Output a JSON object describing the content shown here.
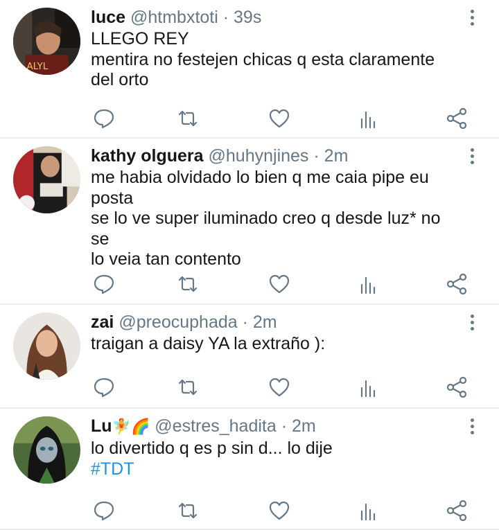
{
  "tweets": [
    {
      "name": "luce",
      "emoji": "",
      "handle": "@htmbxtoti",
      "dot": "·",
      "time": "39s",
      "lines": [
        "LLEGO REY",
        "mentira no festejen chicas q esta claramente",
        "del orto"
      ],
      "hashtag": ""
    },
    {
      "name": "kathy olguera",
      "emoji": "",
      "handle": "@huhynjines",
      "dot": "·",
      "time": "2m",
      "lines": [
        "me habia olvidado lo bien q me caia pipe eu",
        "posta",
        "se lo ve super iluminado creo q desde luz* no se",
        "lo veia tan contento"
      ],
      "hashtag": ""
    },
    {
      "name": "zai",
      "emoji": "",
      "handle": "@preocuphada",
      "dot": "·",
      "time": "2m",
      "lines": [
        "traigan a daisy YA la extraño ):"
      ],
      "hashtag": ""
    },
    {
      "name": "Lu",
      "emoji": "🧚🌈",
      "handle": "@estres_hadita",
      "dot": "·",
      "time": "2m",
      "lines": [
        "lo divertido q es p sin d... lo dije"
      ],
      "hashtag": "#TDT"
    }
  ],
  "icons": {
    "reply": "reply-icon",
    "retweet": "retweet-icon",
    "like": "heart-icon",
    "stats": "analytics-icon",
    "share": "share-icon",
    "more": "more-vertical-icon"
  },
  "colors": {
    "text": "#14171a",
    "muted": "#657786",
    "link": "#1b95e0",
    "divider": "#e6ecf0"
  }
}
